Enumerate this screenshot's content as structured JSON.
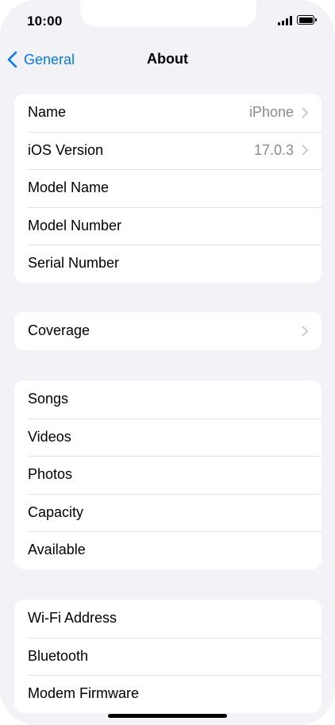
{
  "status_bar": {
    "time": "10:00",
    "signal_icon": "cellular-signal-icon",
    "battery_icon": "battery-icon"
  },
  "nav": {
    "back_label": "General",
    "back_icon": "chevron-left-icon",
    "title": "About",
    "accent": "#007aff"
  },
  "groups": [
    {
      "rows": [
        {
          "label": "Name",
          "value": "iPhone",
          "chevron": true
        },
        {
          "label": "iOS Version",
          "value": "17.0.3",
          "chevron": true
        },
        {
          "label": "Model Name",
          "value": "",
          "chevron": false
        },
        {
          "label": "Model Number",
          "value": "",
          "chevron": false
        },
        {
          "label": "Serial Number",
          "value": "",
          "chevron": false
        }
      ]
    },
    {
      "rows": [
        {
          "label": "Coverage",
          "value": "",
          "chevron": true
        }
      ]
    },
    {
      "rows": [
        {
          "label": "Songs",
          "value": "",
          "chevron": false
        },
        {
          "label": "Videos",
          "value": "",
          "chevron": false
        },
        {
          "label": "Photos",
          "value": "",
          "chevron": false
        },
        {
          "label": "Capacity",
          "value": "",
          "chevron": false
        },
        {
          "label": "Available",
          "value": "",
          "chevron": false
        }
      ]
    },
    {
      "rows": [
        {
          "label": "Wi-Fi Address",
          "value": "",
          "chevron": false
        },
        {
          "label": "Bluetooth",
          "value": "",
          "chevron": false
        },
        {
          "label": "Modem Firmware",
          "value": "",
          "chevron": false
        }
      ]
    }
  ]
}
